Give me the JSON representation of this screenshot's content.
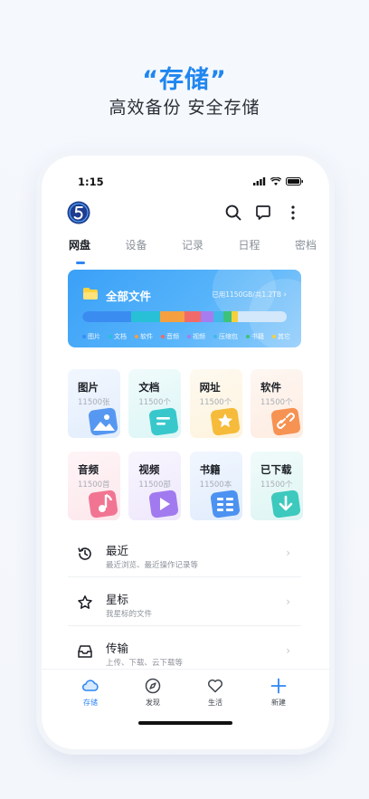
{
  "promo": {
    "title": "“存储”",
    "subtitle": "高效备份 安全存储"
  },
  "status_bar": {
    "time": "1:15"
  },
  "header": {
    "logo_icon": "app-logo-5",
    "actions": [
      {
        "icon": "search-icon"
      },
      {
        "icon": "message-icon"
      },
      {
        "icon": "more-vertical-icon"
      }
    ]
  },
  "tabs": [
    {
      "label": "网盘",
      "active": true
    },
    {
      "label": "设备",
      "active": false
    },
    {
      "label": "记录",
      "active": false
    },
    {
      "label": "日程",
      "active": false
    },
    {
      "label": "密档",
      "active": false
    }
  ],
  "storage_card": {
    "title": "全部文件",
    "usage": "已用1150GB/共1.2TB",
    "segments": [
      {
        "label": "图片",
        "color": "#3b8cf1",
        "fraction": 0.24
      },
      {
        "label": "文档",
        "color": "#27c0d6",
        "fraction": 0.14
      },
      {
        "label": "软件",
        "color": "#f4a040",
        "fraction": 0.12
      },
      {
        "label": "音频",
        "color": "#f06a6a",
        "fraction": 0.08
      },
      {
        "label": "视频",
        "color": "#a67cf0",
        "fraction": 0.06
      },
      {
        "label": "压缩包",
        "color": "#41b8e8",
        "fraction": 0.05
      },
      {
        "label": "书籍",
        "color": "#3cc27a",
        "fraction": 0.04
      },
      {
        "label": "其它",
        "color": "#f6cf3d",
        "fraction": 0.03
      }
    ],
    "legend": [
      {
        "label": "图片",
        "color": "#3b8cf1"
      },
      {
        "label": "文档",
        "color": "#27c0d6"
      },
      {
        "label": "软件",
        "color": "#f4a040"
      },
      {
        "label": "音频",
        "color": "#f06a6a"
      },
      {
        "label": "视频",
        "color": "#a67cf0"
      },
      {
        "label": "压缩包",
        "color": "#41b8e8"
      },
      {
        "label": "书籍",
        "color": "#3cc27a"
      },
      {
        "label": "其它",
        "color": "#f6cf3d"
      }
    ]
  },
  "categories": [
    {
      "name": "图片",
      "count": "11500张",
      "icon": "image-icon",
      "accent": "#4a90f0"
    },
    {
      "name": "文档",
      "count": "11500个",
      "icon": "document-icon",
      "accent": "#29c3c8"
    },
    {
      "name": "网址",
      "count": "11500个",
      "icon": "star-icon",
      "accent": "#f5b52b"
    },
    {
      "name": "软件",
      "count": "11500个",
      "icon": "link-icon",
      "accent": "#f58a45"
    },
    {
      "name": "音频",
      "count": "11500首",
      "icon": "music-icon",
      "accent": "#f06a8a"
    },
    {
      "name": "视频",
      "count": "11500部",
      "icon": "play-icon",
      "accent": "#9a70ee"
    },
    {
      "name": "书籍",
      "count": "11500本",
      "icon": "book-icon",
      "accent": "#3f8af0"
    },
    {
      "name": "已下载",
      "count": "11500个",
      "icon": "download-icon",
      "accent": "#2fc4b8"
    }
  ],
  "list": [
    {
      "title": "最近",
      "subtitle": "最近浏览、最近操作记录等",
      "icon": "history-icon"
    },
    {
      "title": "星标",
      "subtitle": "我星标的文件",
      "icon": "star-outline-icon"
    },
    {
      "title": "传输",
      "subtitle": "上传、下载、云下载等",
      "icon": "transfer-icon"
    }
  ],
  "tabbar": [
    {
      "label": "存储",
      "icon": "cloud-icon",
      "active": true
    },
    {
      "label": "发现",
      "icon": "compass-icon",
      "active": false
    },
    {
      "label": "生活",
      "icon": "heart-icon",
      "active": false
    },
    {
      "label": "新建",
      "icon": "plus-icon",
      "active": false
    }
  ]
}
